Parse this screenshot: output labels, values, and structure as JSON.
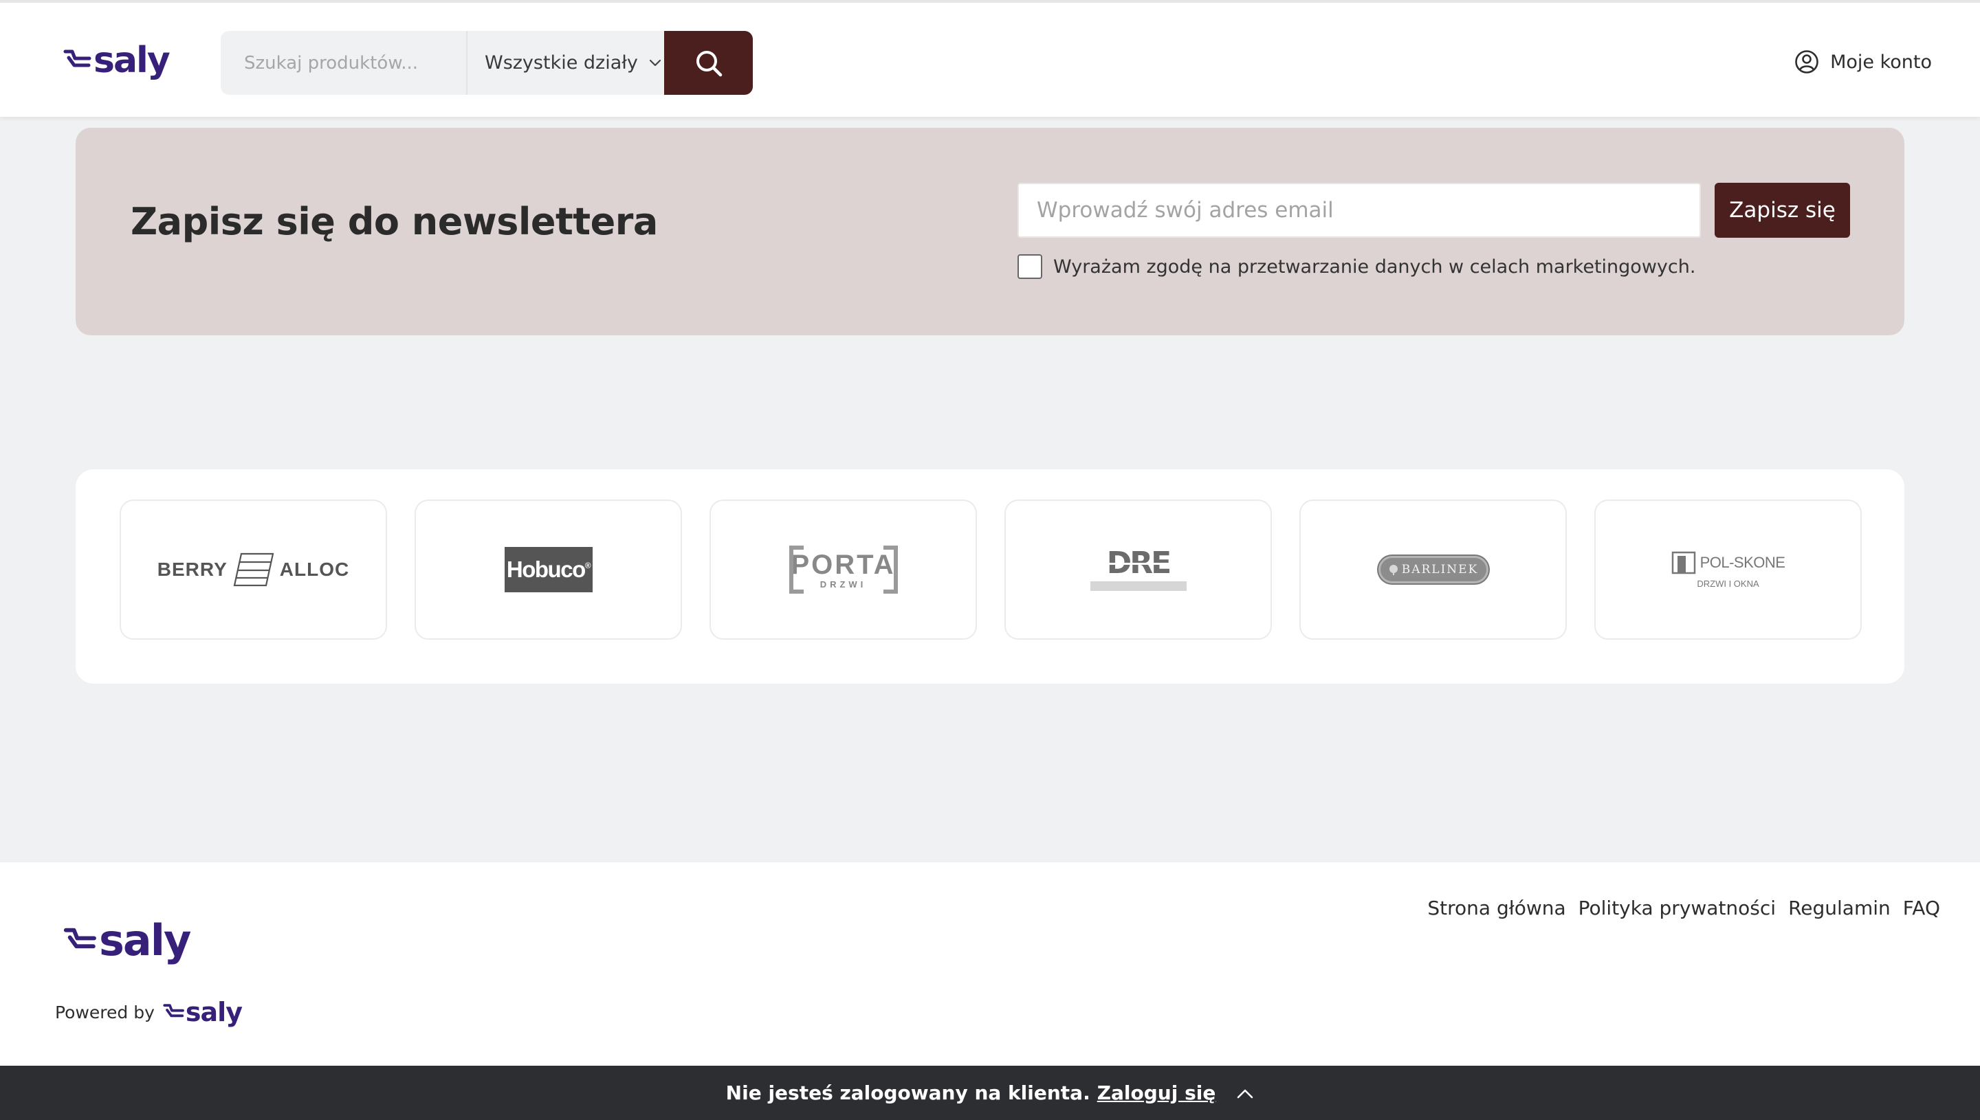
{
  "header": {
    "logo_text": "saly",
    "search": {
      "placeholder": "Szukaj produktów...",
      "value": ""
    },
    "department_select": {
      "selected": "Wszystkie działy"
    },
    "account_label": "Moje konto"
  },
  "newsletter": {
    "title": "Zapisz się do newslettera",
    "email_placeholder": "Wprowadź swój adres email",
    "subscribe_label": "Zapisz się",
    "consent_label": "Wyrażam zgodę na przetwarzanie danych w celach marketingowych.",
    "consent_checked": false
  },
  "brands": [
    {
      "name": "BERRY ALLOC",
      "parts": [
        "BERRY",
        "ALLOC"
      ]
    },
    {
      "name": "Hobuco"
    },
    {
      "name": "PORTA DRZWI",
      "main": "PORTA",
      "sub": "DRZWI"
    },
    {
      "name": "DRE"
    },
    {
      "name": "BARLINEK"
    },
    {
      "name": "POL-SKONE",
      "main": "POL-SKONE",
      "sub": "DRZWI I OKNA"
    }
  ],
  "footer": {
    "logo_text": "saly",
    "links": [
      "Strona główna",
      "Polityka prywatności",
      "Regulamin",
      "FAQ"
    ],
    "powered_by": "Powered by",
    "powered_logo_text": "saly"
  },
  "login_bar": {
    "message": "Nie jesteś zalogowany na klienta.",
    "link": "Zaloguj się"
  },
  "colors": {
    "brand_purple": "#37207a",
    "accent_maroon": "#4a1f1e",
    "newsletter_bg": "#dcd3d2",
    "page_bg": "#f0f1f3",
    "bottom_bar_bg": "#2d2e31"
  }
}
